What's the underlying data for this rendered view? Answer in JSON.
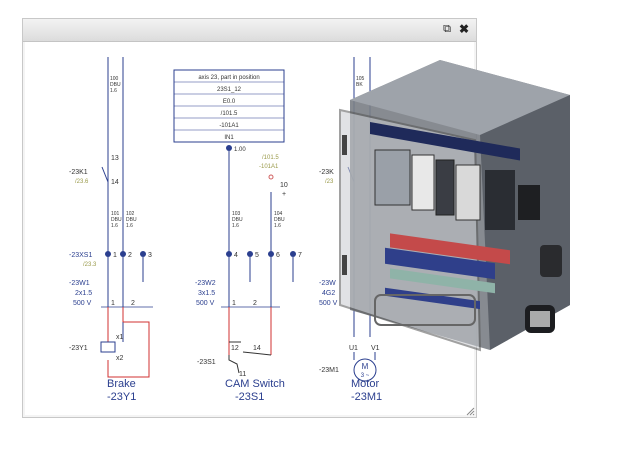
{
  "window": {
    "popout_icon": "popout-icon",
    "close_icon": "close-icon",
    "close_glyph": "✖",
    "popout_glyph": "⧉"
  },
  "schematic": {
    "left": {
      "top_wire": {
        "l1": "100",
        "l2": "DBU",
        "l3": "1.6"
      },
      "relay_ref": "-23K1",
      "relay_sub": "/23.6",
      "contact_top": "13",
      "contact_bot": "14",
      "wire_101": {
        "l1": "101",
        "l2": "DBU",
        "l3": "1.6"
      },
      "wire_102": {
        "l1": "102",
        "l2": "DBU",
        "l3": "1.6"
      },
      "connector_ref": "-23XS1",
      "connector_sub": "/23.3",
      "pins": [
        "1",
        "2",
        "3"
      ],
      "cable_ref": "-23W1",
      "cable_spec": "2x1.5",
      "cable_voltage": "500 V",
      "cable_cores": [
        "1",
        "2"
      ],
      "coil_top": "x1",
      "coil_bot": "x2",
      "device_ref": "-23Y1",
      "title": "Brake",
      "title_ref": "-23Y1"
    },
    "middle": {
      "table_rows": [
        "axis 23, part in position",
        "23S1_12",
        "E0.0",
        "/101.5",
        "-101A1",
        "IN1"
      ],
      "node_label": "1.00",
      "xref_a": "/101.5",
      "xref_b": "-101A1",
      "node_10": "10",
      "node_10_sub": "+",
      "wire_103": {
        "l1": "103",
        "l2": "DBU",
        "l3": "1.6"
      },
      "wire_104": {
        "l1": "104",
        "l2": "DBU",
        "l3": "1.6"
      },
      "pins": [
        "4",
        "5",
        "6",
        "7"
      ],
      "cable_ref": "-23W2",
      "cable_spec": "3x1.5",
      "cable_voltage": "500 V",
      "cable_cores": [
        "1",
        "2"
      ],
      "switch_contacts": [
        "12",
        "14",
        "11"
      ],
      "switch_ref": "-23S1",
      "title": "CAM Switch",
      "title_ref": "-23S1"
    },
    "right": {
      "top_wire": {
        "l1": "105",
        "l2": "BK"
      },
      "relay_ref": "-23K",
      "relay_sub": "/23",
      "cable_ref": "-23W",
      "cable_spec": "4G2",
      "cable_voltage": "500 V",
      "terminals": [
        "U1",
        "V1"
      ],
      "motor_letter": "M",
      "motor_spec": "3 ~",
      "motor_ref": "-23M1",
      "title": "Motor",
      "title_ref": "-23M1"
    }
  }
}
